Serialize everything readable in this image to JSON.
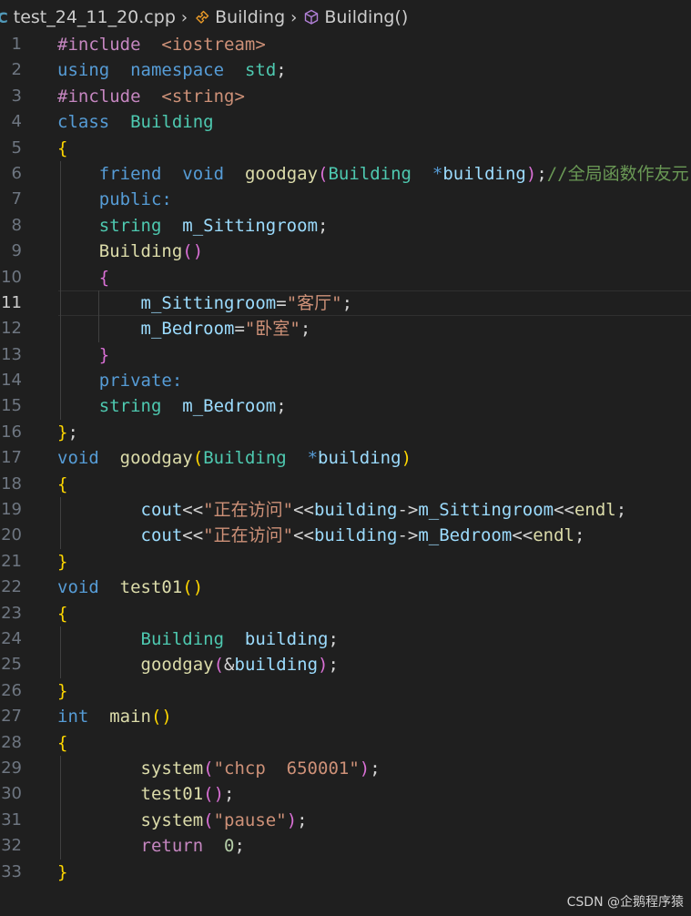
{
  "breadcrumb": {
    "file": "test_24_11_20.cpp",
    "class_name": "Building",
    "method_name": "Building()",
    "file_icon": "cpp-file-icon",
    "class_icon": "symbol-class-icon",
    "method_icon": "symbol-method-icon"
  },
  "editor": {
    "current_line": 11,
    "lines": [
      {
        "n": "1",
        "tokens": [
          {
            "t": "#include",
            "c": "pp"
          },
          {
            "t": "  ",
            "c": "pl"
          },
          {
            "t": "<iostream>",
            "c": "st"
          }
        ]
      },
      {
        "n": "2",
        "tokens": [
          {
            "t": "using",
            "c": "kw"
          },
          {
            "t": "  ",
            "c": "pl"
          },
          {
            "t": "namespace",
            "c": "kw"
          },
          {
            "t": "  ",
            "c": "pl"
          },
          {
            "t": "std",
            "c": "ty"
          },
          {
            "t": ";",
            "c": "pl"
          }
        ]
      },
      {
        "n": "3",
        "tokens": [
          {
            "t": "#include",
            "c": "pp"
          },
          {
            "t": "  ",
            "c": "pl"
          },
          {
            "t": "<string>",
            "c": "st"
          }
        ]
      },
      {
        "n": "4",
        "tokens": [
          {
            "t": "class",
            "c": "kw"
          },
          {
            "t": "  ",
            "c": "pl"
          },
          {
            "t": "Building",
            "c": "ty"
          }
        ]
      },
      {
        "n": "5",
        "tokens": [
          {
            "t": "{",
            "c": "b1"
          }
        ]
      },
      {
        "n": "6",
        "tokens": [
          {
            "t": "    ",
            "c": "pl"
          },
          {
            "t": "friend",
            "c": "kw"
          },
          {
            "t": "  ",
            "c": "pl"
          },
          {
            "t": "void",
            "c": "kw"
          },
          {
            "t": "  ",
            "c": "pl"
          },
          {
            "t": "goodgay",
            "c": "fn"
          },
          {
            "t": "(",
            "c": "b2"
          },
          {
            "t": "Building",
            "c": "ty"
          },
          {
            "t": "  ",
            "c": "pl"
          },
          {
            "t": "*",
            "c": "kw"
          },
          {
            "t": "building",
            "c": "vr"
          },
          {
            "t": ")",
            "c": "b2"
          },
          {
            "t": ";",
            "c": "pl"
          },
          {
            "t": "//全局函数作友元",
            "c": "cm"
          }
        ]
      },
      {
        "n": "7",
        "tokens": [
          {
            "t": "    ",
            "c": "pl"
          },
          {
            "t": "public:",
            "c": "kw"
          }
        ]
      },
      {
        "n": "8",
        "tokens": [
          {
            "t": "    ",
            "c": "pl"
          },
          {
            "t": "string",
            "c": "ty"
          },
          {
            "t": "  ",
            "c": "pl"
          },
          {
            "t": "m_Sittingroom",
            "c": "vr"
          },
          {
            "t": ";",
            "c": "pl"
          }
        ]
      },
      {
        "n": "9",
        "tokens": [
          {
            "t": "    ",
            "c": "pl"
          },
          {
            "t": "Building",
            "c": "fn"
          },
          {
            "t": "()",
            "c": "b2"
          }
        ]
      },
      {
        "n": "10",
        "tokens": [
          {
            "t": "    ",
            "c": "pl"
          },
          {
            "t": "{",
            "c": "b2"
          }
        ]
      },
      {
        "n": "11",
        "tokens": [
          {
            "t": "        ",
            "c": "pl"
          },
          {
            "t": "m_Sittingroom",
            "c": "vr"
          },
          {
            "t": "=",
            "c": "pl"
          },
          {
            "t": "\"客厅\"",
            "c": "st"
          },
          {
            "t": ";",
            "c": "pl"
          }
        ]
      },
      {
        "n": "12",
        "tokens": [
          {
            "t": "        ",
            "c": "pl"
          },
          {
            "t": "m_Bedroom",
            "c": "vr"
          },
          {
            "t": "=",
            "c": "pl"
          },
          {
            "t": "\"卧室\"",
            "c": "st"
          },
          {
            "t": ";",
            "c": "pl"
          }
        ]
      },
      {
        "n": "13",
        "tokens": [
          {
            "t": "    ",
            "c": "pl"
          },
          {
            "t": "}",
            "c": "b2"
          }
        ]
      },
      {
        "n": "14",
        "tokens": [
          {
            "t": "    ",
            "c": "pl"
          },
          {
            "t": "private:",
            "c": "kw"
          }
        ]
      },
      {
        "n": "15",
        "tokens": [
          {
            "t": "    ",
            "c": "pl"
          },
          {
            "t": "string",
            "c": "ty"
          },
          {
            "t": "  ",
            "c": "pl"
          },
          {
            "t": "m_Bedroom",
            "c": "vr"
          },
          {
            "t": ";",
            "c": "pl"
          }
        ]
      },
      {
        "n": "16",
        "tokens": [
          {
            "t": "}",
            "c": "b1"
          },
          {
            "t": ";",
            "c": "pl"
          }
        ]
      },
      {
        "n": "17",
        "tokens": [
          {
            "t": "void",
            "c": "kw"
          },
          {
            "t": "  ",
            "c": "pl"
          },
          {
            "t": "goodgay",
            "c": "fn"
          },
          {
            "t": "(",
            "c": "b1"
          },
          {
            "t": "Building",
            "c": "ty"
          },
          {
            "t": "  ",
            "c": "pl"
          },
          {
            "t": "*",
            "c": "kw"
          },
          {
            "t": "building",
            "c": "vr"
          },
          {
            "t": ")",
            "c": "b1"
          }
        ]
      },
      {
        "n": "18",
        "tokens": [
          {
            "t": "{",
            "c": "b1"
          }
        ]
      },
      {
        "n": "19",
        "tokens": [
          {
            "t": "        ",
            "c": "pl"
          },
          {
            "t": "cout",
            "c": "vr"
          },
          {
            "t": "<<",
            "c": "pl"
          },
          {
            "t": "\"正在访问\"",
            "c": "st"
          },
          {
            "t": "<<",
            "c": "pl"
          },
          {
            "t": "building",
            "c": "vr"
          },
          {
            "t": "->",
            "c": "pl"
          },
          {
            "t": "m_Sittingroom",
            "c": "vr"
          },
          {
            "t": "<<",
            "c": "pl"
          },
          {
            "t": "endl",
            "c": "fn"
          },
          {
            "t": ";",
            "c": "pl"
          }
        ]
      },
      {
        "n": "20",
        "tokens": [
          {
            "t": "        ",
            "c": "pl"
          },
          {
            "t": "cout",
            "c": "vr"
          },
          {
            "t": "<<",
            "c": "pl"
          },
          {
            "t": "\"正在访问\"",
            "c": "st"
          },
          {
            "t": "<<",
            "c": "pl"
          },
          {
            "t": "building",
            "c": "vr"
          },
          {
            "t": "->",
            "c": "pl"
          },
          {
            "t": "m_Bedroom",
            "c": "vr"
          },
          {
            "t": "<<",
            "c": "pl"
          },
          {
            "t": "endl",
            "c": "fn"
          },
          {
            "t": ";",
            "c": "pl"
          }
        ]
      },
      {
        "n": "21",
        "tokens": [
          {
            "t": "}",
            "c": "b1"
          }
        ]
      },
      {
        "n": "22",
        "tokens": [
          {
            "t": "void",
            "c": "kw"
          },
          {
            "t": "  ",
            "c": "pl"
          },
          {
            "t": "test01",
            "c": "fn"
          },
          {
            "t": "()",
            "c": "b1"
          }
        ]
      },
      {
        "n": "23",
        "tokens": [
          {
            "t": "{",
            "c": "b1"
          }
        ]
      },
      {
        "n": "24",
        "tokens": [
          {
            "t": "        ",
            "c": "pl"
          },
          {
            "t": "Building",
            "c": "ty"
          },
          {
            "t": "  ",
            "c": "pl"
          },
          {
            "t": "building",
            "c": "vr"
          },
          {
            "t": ";",
            "c": "pl"
          }
        ]
      },
      {
        "n": "25",
        "tokens": [
          {
            "t": "        ",
            "c": "pl"
          },
          {
            "t": "goodgay",
            "c": "fn"
          },
          {
            "t": "(",
            "c": "b2"
          },
          {
            "t": "&",
            "c": "pl"
          },
          {
            "t": "building",
            "c": "vr"
          },
          {
            "t": ")",
            "c": "b2"
          },
          {
            "t": ";",
            "c": "pl"
          }
        ]
      },
      {
        "n": "26",
        "tokens": [
          {
            "t": "}",
            "c": "b1"
          }
        ]
      },
      {
        "n": "27",
        "tokens": [
          {
            "t": "int",
            "c": "kw"
          },
          {
            "t": "  ",
            "c": "pl"
          },
          {
            "t": "main",
            "c": "fn"
          },
          {
            "t": "()",
            "c": "b1"
          }
        ]
      },
      {
        "n": "28",
        "tokens": [
          {
            "t": "{",
            "c": "b1"
          }
        ]
      },
      {
        "n": "29",
        "tokens": [
          {
            "t": "        ",
            "c": "pl"
          },
          {
            "t": "system",
            "c": "fn"
          },
          {
            "t": "(",
            "c": "b2"
          },
          {
            "t": "\"chcp  650001\"",
            "c": "st"
          },
          {
            "t": ")",
            "c": "b2"
          },
          {
            "t": ";",
            "c": "pl"
          }
        ]
      },
      {
        "n": "30",
        "tokens": [
          {
            "t": "        ",
            "c": "pl"
          },
          {
            "t": "test01",
            "c": "fn"
          },
          {
            "t": "()",
            "c": "b2"
          },
          {
            "t": ";",
            "c": "pl"
          }
        ]
      },
      {
        "n": "31",
        "tokens": [
          {
            "t": "        ",
            "c": "pl"
          },
          {
            "t": "system",
            "c": "fn"
          },
          {
            "t": "(",
            "c": "b2"
          },
          {
            "t": "\"pause\"",
            "c": "st"
          },
          {
            "t": ")",
            "c": "b2"
          },
          {
            "t": ";",
            "c": "pl"
          }
        ]
      },
      {
        "n": "32",
        "tokens": [
          {
            "t": "        ",
            "c": "pl"
          },
          {
            "t": "return",
            "c": "pp"
          },
          {
            "t": "  ",
            "c": "pl"
          },
          {
            "t": "0",
            "c": "nm"
          },
          {
            "t": ";",
            "c": "pl"
          }
        ]
      },
      {
        "n": "33",
        "tokens": [
          {
            "t": "}",
            "c": "b1"
          }
        ]
      }
    ]
  },
  "watermark": "CSDN @企鹅程序猿"
}
